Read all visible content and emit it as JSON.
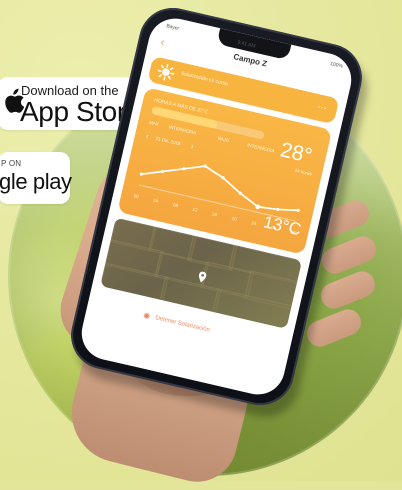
{
  "badges": {
    "app_store_small": "Download on the",
    "app_store_large": "App Store",
    "google_play_small": "P ON",
    "google_play_large": "gle play"
  },
  "phone": {
    "status": {
      "carrier": "Bayer",
      "time": "9:41 AM",
      "battery": "100%"
    },
    "header": {
      "title": "Campo Z"
    },
    "sun_row": {
      "label": "Solarización en curso"
    },
    "weather": {
      "top_label": "HORAS A MÁS DE 37°C",
      "progress": 0.58,
      "day_labels": [
        "MAX",
        "INTERMEDIA",
        "BAJO",
        "INTERMEDIA"
      ],
      "date": "01 Dic, 2018",
      "period": "24 horas",
      "temp_top": "28°",
      "temp_bottom": "13°C",
      "x_ticks": [
        "00",
        "04",
        "08",
        "12",
        "16",
        "20",
        "24",
        "04",
        "08"
      ]
    },
    "footer": {
      "stop_label": "Detener Solarización"
    }
  },
  "colors": {
    "orange": "#f7b43f",
    "deep_orange": "#f5a63f",
    "stop": "#f08b67"
  },
  "chart_data": {
    "type": "line",
    "x": [
      "00",
      "04",
      "08",
      "12",
      "16",
      "20",
      "24",
      "04",
      "08"
    ],
    "series": [
      {
        "values": [
          16,
          20,
          24,
          28,
          24,
          18,
          13,
          14,
          16
        ]
      }
    ]
  }
}
